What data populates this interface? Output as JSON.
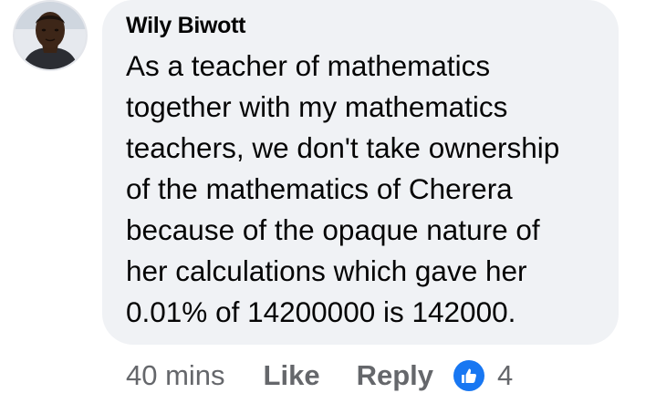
{
  "comment": {
    "author": "Wily Biwott",
    "text_lines": [
      "As  a teacher of mathematics",
      "together with my mathematics",
      "teachers, we don't take ownership",
      "of the mathematics of Cherera",
      "because of the opaque nature of",
      "her calculations which gave her",
      "0.01% of 14200000 is 142000."
    ],
    "timestamp": "40 mins",
    "actions": {
      "like_label": "Like",
      "reply_label": "Reply"
    },
    "reaction": {
      "icon": "thumbs-up-icon",
      "count": "4",
      "color": "#1877f2"
    }
  },
  "colors": {
    "bubble_bg": "#f0f2f5",
    "text": "#050505",
    "secondary_text": "#65676b"
  }
}
